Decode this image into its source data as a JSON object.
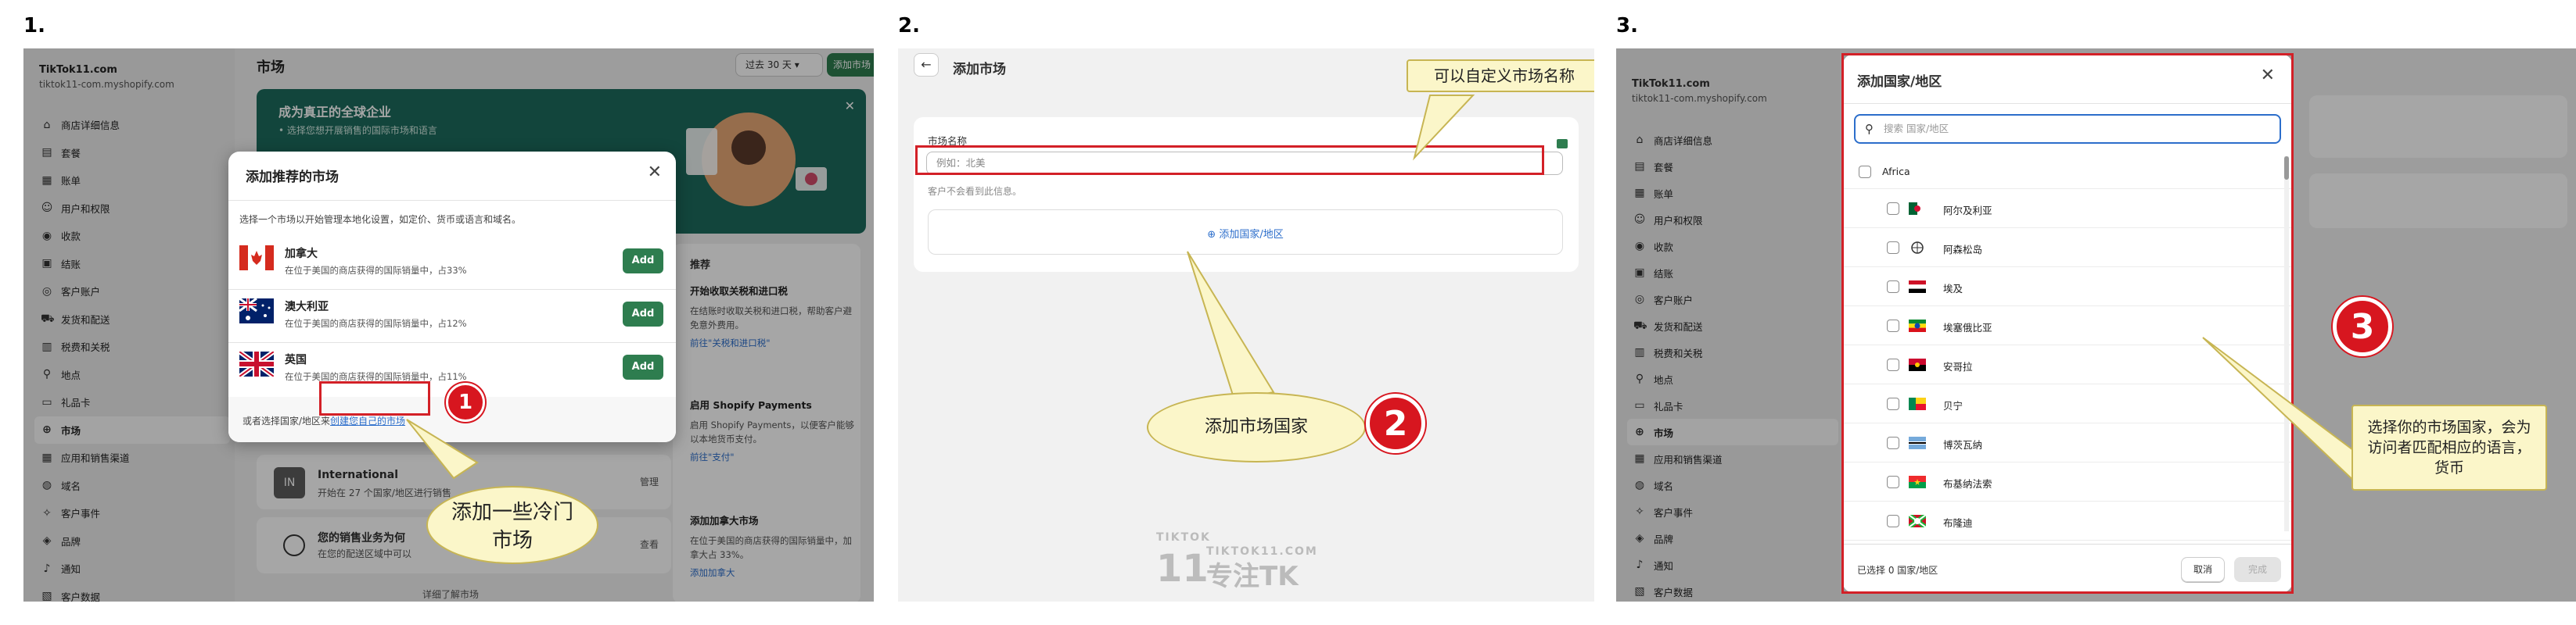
{
  "steps": [
    "1.",
    "2.",
    "3."
  ],
  "panel1": {
    "shop_name": "TikTok11.com",
    "shop_domain": "tiktok11-com.myshopify.com",
    "nav": [
      {
        "label": "商店详细信息",
        "icon": "store-icon"
      },
      {
        "label": "套餐",
        "icon": "plan-icon"
      },
      {
        "label": "账单",
        "icon": "billing-icon"
      },
      {
        "label": "用户和权限",
        "icon": "user-icon"
      },
      {
        "label": "收款",
        "icon": "payment-icon"
      },
      {
        "label": "结账",
        "icon": "checkout-icon"
      },
      {
        "label": "客户账户",
        "icon": "customer-icon"
      },
      {
        "label": "发货和配送",
        "icon": "shipping-icon"
      },
      {
        "label": "税费和关税",
        "icon": "tax-icon"
      },
      {
        "label": "地点",
        "icon": "location-icon"
      },
      {
        "label": "礼品卡",
        "icon": "giftcard-icon"
      },
      {
        "label": "市场",
        "icon": "globe-icon",
        "active": true
      },
      {
        "label": "应用和销售渠道",
        "icon": "apps-icon"
      },
      {
        "label": "域名",
        "icon": "domain-icon"
      },
      {
        "label": "客户事件",
        "icon": "events-icon"
      },
      {
        "label": "品牌",
        "icon": "brand-icon"
      },
      {
        "label": "通知",
        "icon": "bell-icon"
      },
      {
        "label": "客户数据",
        "icon": "data-icon"
      }
    ],
    "page_title": "市场",
    "date_range": "过去 30 天",
    "add_market": "添加市场",
    "banner_title": "成为真正的全球企业",
    "banner_sub": "• 选择您想开展销售的国际市场和语言",
    "recommend_title": "推荐",
    "rec_blocks": [
      {
        "h": "开始收取关税和进口税",
        "p": "在结账时收取关税和进口税，帮助客户避免意外费用。",
        "l": "前往\"关税和进口税\""
      },
      {
        "h": "启用 Shopify Payments",
        "p": "启用 Shopify Payments，以便客户能够以本地货币支付。",
        "l": "前往\"支付\""
      },
      {
        "h": "添加加拿大市场",
        "p": "在位于美国的商店获得的国际销量中，加拿大占 33%。",
        "l": "添加加拿大"
      }
    ],
    "international": {
      "badge": "IN",
      "name": "International",
      "desc": "开始在 27 个国家/地区进行销售",
      "manage": "管理"
    },
    "business": {
      "name": "您的销售业务为何",
      "desc": "在您的配送区域中可以",
      "manage": "查看"
    },
    "footer_link": "详细了解市场",
    "modal": {
      "title": "添加推荐的市场",
      "desc": "选择一个市场以开始管理本地化设置，如定价、货币或语言和域名。",
      "rows": [
        {
          "name": "加拿大",
          "desc": "在位于美国的商店获得的国际销量中，占33%",
          "btn": "Add"
        },
        {
          "name": "澳大利亚",
          "desc": "在位于美国的商店获得的国际销量中，占12%",
          "btn": "Add"
        },
        {
          "name": "英国",
          "desc": "在位于美国的商店获得的国际销量中，占11%",
          "btn": "Add"
        }
      ],
      "footer_text": "或者选择国家/地区来",
      "footer_link": "创建您自己的市场"
    },
    "badge_num": "1",
    "callout": "添加一些冷门市场"
  },
  "panel2": {
    "title": "添加市场",
    "label": "市场名称",
    "placeholder": "例如：北美",
    "hint": "客户不会看到此信息。",
    "add_region": "添加国家/地区",
    "callout_top": "可以自定义市场名称",
    "callout_bottom": "添加市场国家",
    "badge_num": "2",
    "watermark_a": "TIKTOK",
    "watermark_b": "TIKTOK11.COM",
    "watermark_c": "专注TK",
    "watermark_logo": "11"
  },
  "panel3": {
    "shop_name": "TikTok11.com",
    "shop_domain": "tiktok11-com.myshopify.com",
    "modal": {
      "title": "添加国家/地区",
      "search_placeholder": "搜索 国家/地区",
      "region": "Africa",
      "countries": [
        {
          "name": "阿尔及利亚",
          "flag": "dz"
        },
        {
          "name": "阿森松岛",
          "flag": "globe"
        },
        {
          "name": "埃及",
          "flag": "eg"
        },
        {
          "name": "埃塞俄比亚",
          "flag": "et"
        },
        {
          "name": "安哥拉",
          "flag": "ao"
        },
        {
          "name": "贝宁",
          "flag": "bj"
        },
        {
          "name": "博茨瓦纳",
          "flag": "bw"
        },
        {
          "name": "布基纳法索",
          "flag": "bf"
        },
        {
          "name": "布隆迪",
          "flag": "bi"
        }
      ],
      "selected": "已选择 0 国家/地区",
      "cancel": "取消",
      "done": "完成"
    },
    "badge_num": "3",
    "callout": "选择你的市场国家，会为访问者匹配相应的语言，货币"
  }
}
